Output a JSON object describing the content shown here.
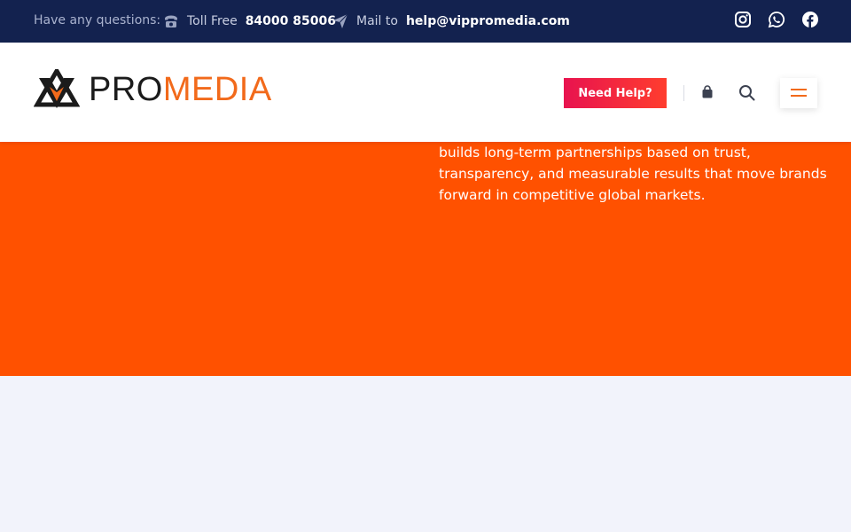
{
  "topbar": {
    "question": "Have any questions:",
    "toll_label": "Toll Free",
    "toll_number": "84000 85006",
    "mail_label": "Mail to",
    "mail_address": "help@vippromedia.com",
    "social": [
      "instagram-icon",
      "whatsapp-icon",
      "facebook-icon"
    ]
  },
  "header": {
    "logo_part1": "PRO",
    "logo_part2": "MEDIA",
    "need_help": "Need Help?",
    "icons": [
      "shopping-bag-icon",
      "search-icon",
      "hamburger-menu-icon"
    ]
  },
  "hero": {
    "text": "builds long-term partnerships based on trust, transparency, and measurable results that move brands forward in competitive global markets."
  },
  "colors": {
    "topbar_bg": "#13224f",
    "accent_orange": "#ff5100",
    "button_gradient_start": "#e8134f",
    "button_gradient_end": "#ff3d2e",
    "page_bg": "#f2f3fb"
  }
}
